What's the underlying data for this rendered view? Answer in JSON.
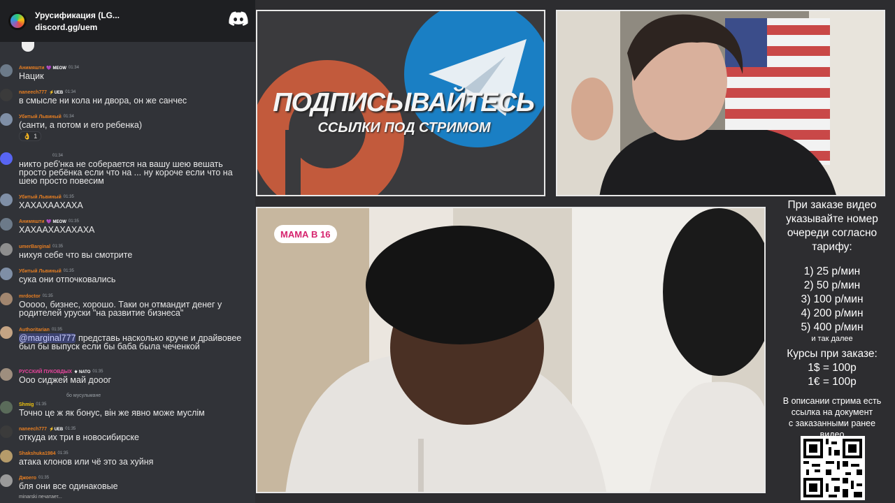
{
  "colors": {
    "chat_bg": "#313338",
    "header_bg": "#1e1f22",
    "accent_discord": "#5865f2",
    "panel_border": "#e8e8e8",
    "show_badge": "#d6246e"
  },
  "chat": {
    "server_name": "Урусификация (LG...",
    "invite": "discord.gg/uem",
    "logo_icon": "discord-icon",
    "messages": [
      {
        "user": "Анимяшти",
        "user_color": "#e67e22",
        "badge": "💜 MEOW",
        "time": "01:34",
        "text": "Нацик"
      },
      {
        "user": "naneech777",
        "user_color": "#e67e22",
        "badge": "⚡UEB",
        "time": "01:34",
        "text": "в смысле ни кола ни двора, он же санчес"
      },
      {
        "user": "Убитый Львиный",
        "user_color": "#e67e22",
        "badge": "",
        "time": "01:34",
        "text": "(санти, а потом и его ребенка)",
        "reaction_count": "1"
      },
      {
        "user": "",
        "user_color": "#ccc",
        "badge": "",
        "time": "01:34",
        "text": "никто реб'нка не соберается на вашу шею вешать просто ребёнка если что на ... ну короче если что на шею просто повесим"
      },
      {
        "user": "Убитый Львиный",
        "user_color": "#e67e22",
        "badge": "",
        "time": "01:35",
        "text": "ХАХАХААХАХА"
      },
      {
        "user": "Анимяшти",
        "user_color": "#e67e22",
        "badge": "💜 MEOW",
        "time": "01:35",
        "text": "ХАХААХАХАХАХА"
      },
      {
        "user": "umerBarginal",
        "user_color": "#e67e22",
        "badge": "",
        "time": "01:35",
        "text": "нихуя себе что вы смотрите"
      },
      {
        "user": "Убитый Львиный",
        "user_color": "#e67e22",
        "badge": "",
        "time": "01:35",
        "text": "сука они отпочковались"
      },
      {
        "user": "mrdoctor",
        "user_color": "#e67e22",
        "badge": "",
        "time": "01:35",
        "text": "Ооооо, бизнес, хорошо. Таки он отмандит денег у родителей уруски \"на развитие бизнеса\""
      },
      {
        "user": "Authoritarian",
        "user_color": "#e67e22",
        "badge": "",
        "time": "01:35",
        "mention": "@marginal777",
        "text": " представь насколько круче и драйвовее был бы выпуск если бы баба была чеченкой"
      },
      {
        "user": "РУССКИЙ ПУКОВДЫХ",
        "user_color": "#eb459e",
        "badge": "⚜ NATO",
        "time": "01:35",
        "text": "Ооо сиджей май дооог"
      },
      {
        "user": "Shmig",
        "user_color": "#f1c40f",
        "badge": "",
        "time": "01:35",
        "reply": "бо мусульмане",
        "text": "Точно це ж як бонус, він же явно може муслім"
      },
      {
        "user": "naneech777",
        "user_color": "#e67e22",
        "badge": "⚡UEB",
        "time": "01:35",
        "text": "откуда их три в новосибирске"
      },
      {
        "user": "Shakshuka1984",
        "user_color": "#e67e22",
        "badge": "",
        "time": "01:35",
        "text": "атака клонов или чё это за хуйня"
      },
      {
        "user": "Джоего",
        "user_color": "#e67e22",
        "badge": "",
        "time": "01:35",
        "text": "бля они все одинаковые"
      }
    ],
    "typing": "minarski печатает..."
  },
  "promo": {
    "headline": "ПОДПИСЫВАЙТЕСЬ",
    "subline": "ССЫЛКИ ПОД СТРИМОМ",
    "icons": [
      "patreon-icon",
      "telegram-icon"
    ]
  },
  "video": {
    "show_badge": "МАМА В 16"
  },
  "order_info": {
    "head": [
      "При заказе видео",
      "указывайте номер",
      "очереди согласно",
      "тарифу:"
    ],
    "tariffs": [
      "1) 25 р/мин",
      "2) 50 р/мин",
      "3) 100 р/мин",
      "4) 200 р/мин",
      "5) 400 р/мин"
    ],
    "and_more": "и так далее",
    "rates_title": "Курсы при заказе:",
    "rates": [
      "1$ = 100р",
      "1€ = 100р"
    ],
    "desc": [
      "В описании стрима есть",
      "ссылка на документ",
      "с заказанными ранее",
      "видео"
    ]
  }
}
